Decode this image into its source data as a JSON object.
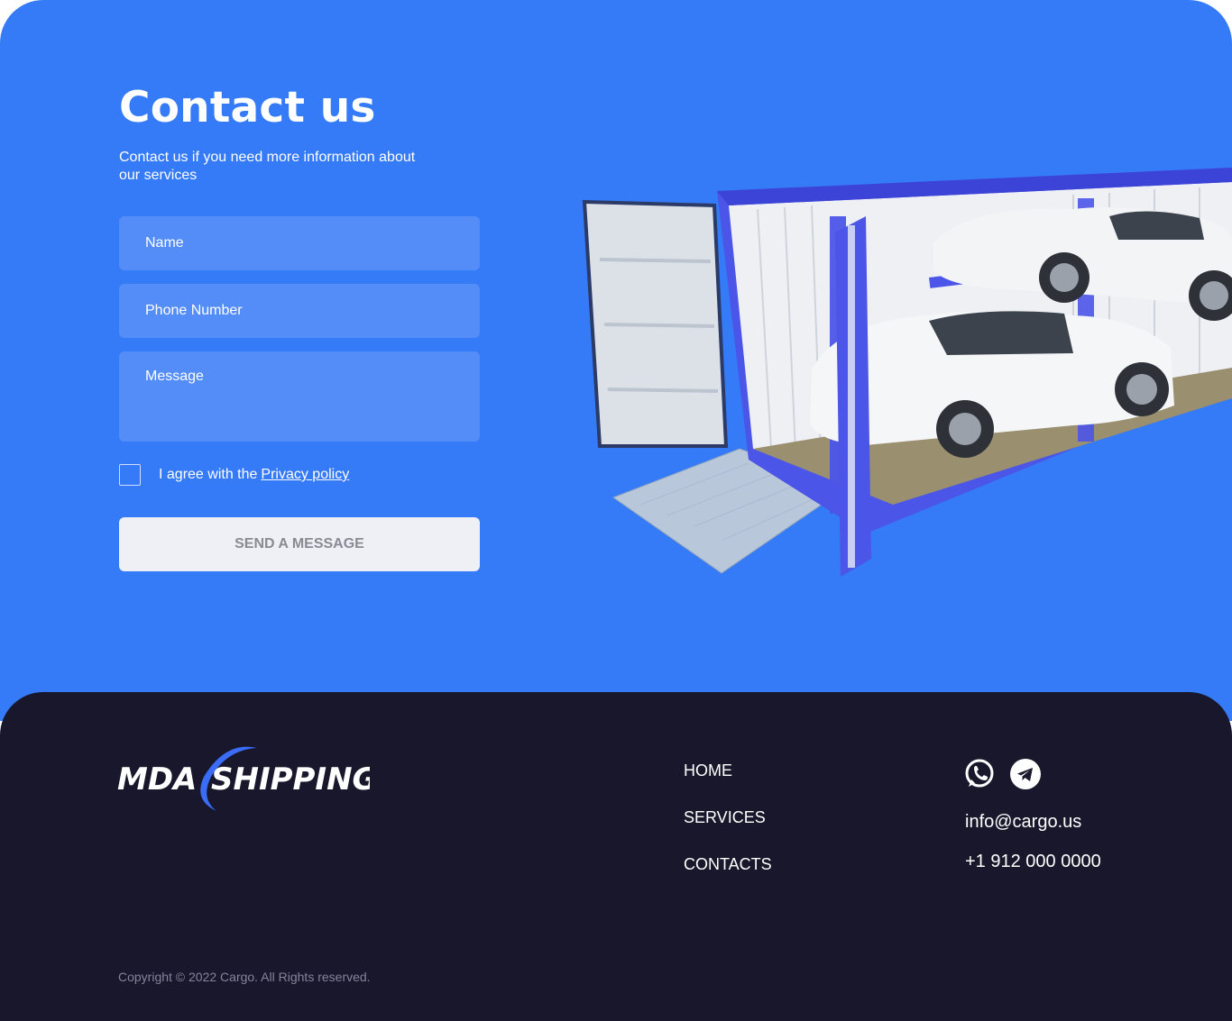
{
  "contact": {
    "title": "Contact us",
    "subtitle": "Contact us if you need more information about our services",
    "name_placeholder": "Name",
    "phone_placeholder": "Phone Number",
    "message_placeholder": "Message",
    "agree_text": "I agree with the",
    "privacy_link": "Privacy policy",
    "send_label": "SEND A MESSAGE"
  },
  "footer": {
    "logo_text_left": "MDA",
    "logo_text_right": "SHIPPING",
    "nav": {
      "home": "HOME",
      "services": "SERVICES",
      "contacts": "CONTACTS"
    },
    "social_icons": [
      "whatsapp-icon",
      "telegram-icon"
    ],
    "email": "info@cargo.us",
    "phone": "+1 912 000 0000",
    "copyright": "Copyright © 2022 Cargo. All Rights reserved."
  },
  "colors": {
    "accent": "#357af6",
    "input_bg": "#558df8",
    "footer_bg": "#18172c",
    "button_bg": "#efeff6"
  }
}
